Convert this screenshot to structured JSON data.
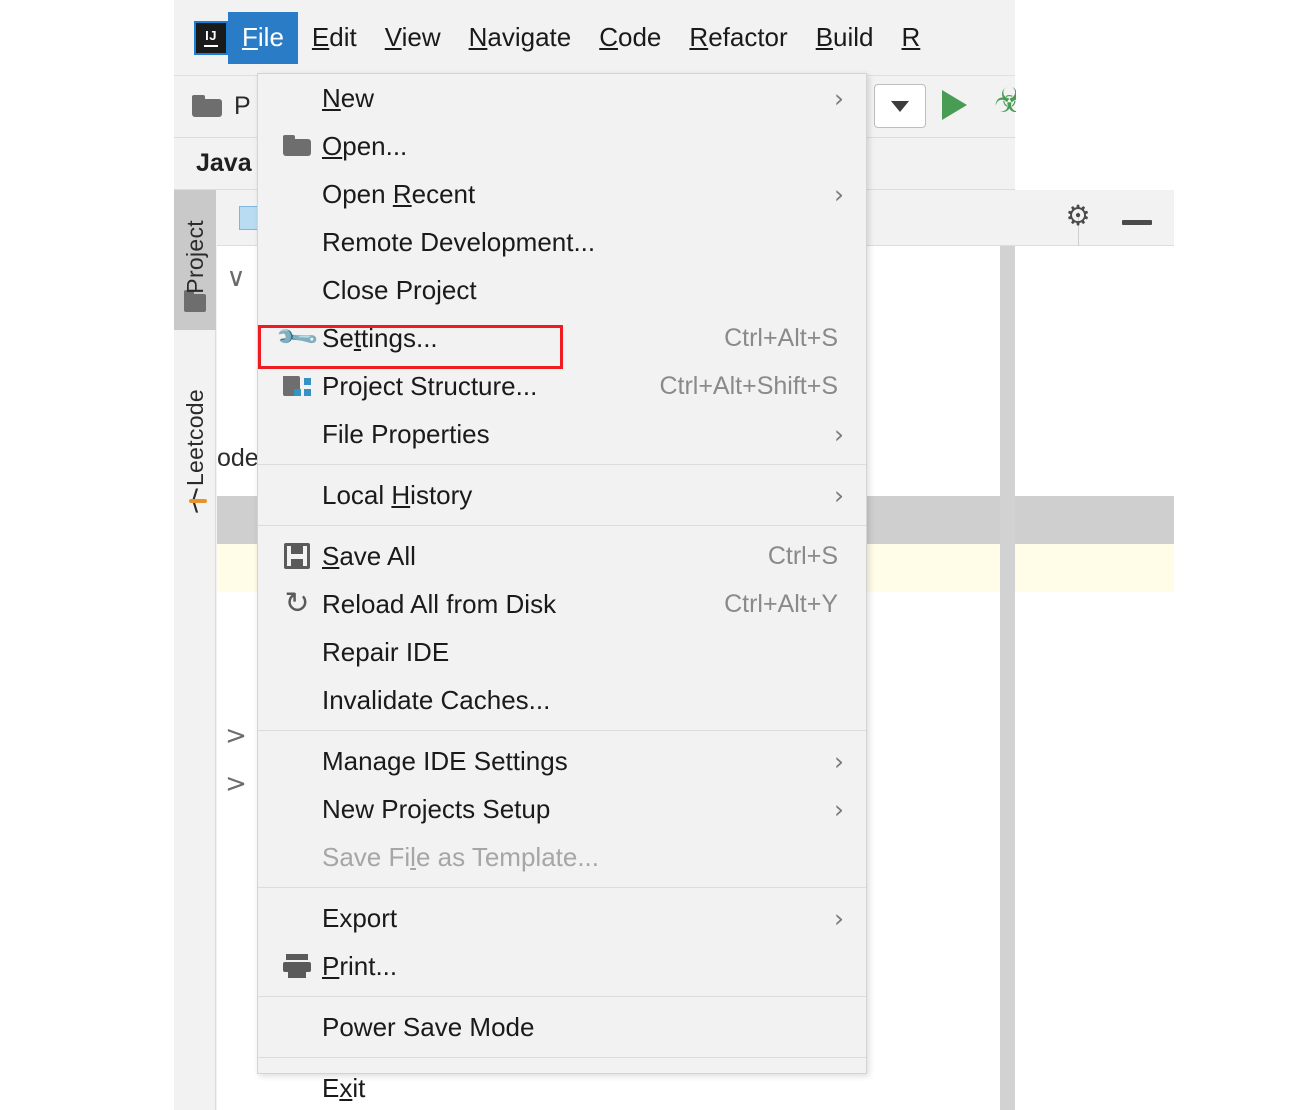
{
  "app": {
    "logo_text": "IJ",
    "breadcrumb": "Java"
  },
  "menubar": {
    "items": [
      {
        "label": "File",
        "mnemonic": "F",
        "active": true
      },
      {
        "label": "Edit",
        "mnemonic": "E",
        "active": false
      },
      {
        "label": "View",
        "mnemonic": "V",
        "active": false
      },
      {
        "label": "Navigate",
        "mnemonic": "N",
        "active": false
      },
      {
        "label": "Code",
        "mnemonic": "C",
        "active": false
      },
      {
        "label": "Refactor",
        "mnemonic": "R",
        "active": false
      },
      {
        "label": "Build",
        "mnemonic": "B",
        "active": false
      },
      {
        "label": "R",
        "mnemonic": "R",
        "active": false
      }
    ]
  },
  "toolbar": {
    "project_label": "P",
    "folder_icon": "open-folder-icon",
    "combo_icon": "chevron-down-icon",
    "run_icon": "run-triangle-icon",
    "debug_icon": "debug-bug-icon"
  },
  "sidebar": {
    "tabs": [
      {
        "label": "Project",
        "icon": "folder-icon",
        "selected": true
      },
      {
        "label": "Leetcode",
        "icon": "leetcode-icon",
        "selected": false
      }
    ]
  },
  "project_panel": {
    "header": {
      "file_icon": "file-icon",
      "gear_icon": "gear-icon",
      "gear_glyph": "⚙",
      "minimize_icon": "minimize-icon"
    },
    "partial_text": "ode",
    "rows": [
      {
        "chevron": "∨",
        "text": ""
      },
      {
        "chevron": ">",
        "text": ""
      },
      {
        "chevron": ">",
        "text": ""
      }
    ]
  },
  "file_menu": {
    "groups": [
      {
        "items": [
          {
            "label": "New",
            "mnemonic": "N",
            "icon": null,
            "shortcut": null,
            "submenu": true,
            "disabled": false
          },
          {
            "label": "Open...",
            "mnemonic": "O",
            "icon": "open-folder-icon",
            "shortcut": null,
            "submenu": false,
            "disabled": false
          },
          {
            "label": "Open Recent",
            "mnemonic": "R",
            "icon": null,
            "shortcut": null,
            "submenu": true,
            "disabled": false
          },
          {
            "label": "Remote Development...",
            "mnemonic": null,
            "icon": null,
            "shortcut": null,
            "submenu": false,
            "disabled": false
          },
          {
            "label": "Close Project",
            "mnemonic": null,
            "icon": null,
            "shortcut": null,
            "submenu": false,
            "disabled": false
          },
          {
            "label": "Settings...",
            "mnemonic": "t",
            "icon": "wrench-icon",
            "shortcut": "Ctrl+Alt+S",
            "submenu": false,
            "disabled": false,
            "highlighted": true
          },
          {
            "label": "Project Structure...",
            "mnemonic": null,
            "icon": "project-structure-icon",
            "shortcut": "Ctrl+Alt+Shift+S",
            "submenu": false,
            "disabled": false
          },
          {
            "label": "File Properties",
            "mnemonic": null,
            "icon": null,
            "shortcut": null,
            "submenu": true,
            "disabled": false
          }
        ]
      },
      {
        "items": [
          {
            "label": "Local History",
            "mnemonic": "H",
            "icon": null,
            "shortcut": null,
            "submenu": true,
            "disabled": false
          }
        ]
      },
      {
        "items": [
          {
            "label": "Save All",
            "mnemonic": "S",
            "icon": "save-icon",
            "shortcut": "Ctrl+S",
            "submenu": false,
            "disabled": false
          },
          {
            "label": "Reload All from Disk",
            "mnemonic": null,
            "icon": "reload-icon",
            "shortcut": "Ctrl+Alt+Y",
            "submenu": false,
            "disabled": false
          },
          {
            "label": "Repair IDE",
            "mnemonic": null,
            "icon": null,
            "shortcut": null,
            "submenu": false,
            "disabled": false
          },
          {
            "label": "Invalidate Caches...",
            "mnemonic": null,
            "icon": null,
            "shortcut": null,
            "submenu": false,
            "disabled": false
          }
        ]
      },
      {
        "items": [
          {
            "label": "Manage IDE Settings",
            "mnemonic": null,
            "icon": null,
            "shortcut": null,
            "submenu": true,
            "disabled": false
          },
          {
            "label": "New Projects Setup",
            "mnemonic": null,
            "icon": null,
            "shortcut": null,
            "submenu": true,
            "disabled": false
          },
          {
            "label": "Save File as Template...",
            "mnemonic": "l",
            "icon": null,
            "shortcut": null,
            "submenu": false,
            "disabled": true
          }
        ]
      },
      {
        "items": [
          {
            "label": "Export",
            "mnemonic": null,
            "icon": null,
            "shortcut": null,
            "submenu": true,
            "disabled": false
          },
          {
            "label": "Print...",
            "mnemonic": "P",
            "icon": "print-icon",
            "shortcut": null,
            "submenu": false,
            "disabled": false
          }
        ]
      },
      {
        "items": [
          {
            "label": "Power Save Mode",
            "mnemonic": null,
            "icon": null,
            "shortcut": null,
            "submenu": false,
            "disabled": false
          }
        ]
      },
      {
        "items": [
          {
            "label": "Exit",
            "mnemonic": "x",
            "icon": null,
            "shortcut": null,
            "submenu": false,
            "disabled": false
          }
        ]
      }
    ],
    "submenu_glyph": "›"
  },
  "annotation": {
    "type": "red-rectangle-highlight",
    "target": "Settings...",
    "color": "#ef1b21"
  },
  "colors": {
    "menubar_bg": "#f2f2f2",
    "active_menu_bg": "#2a7cc7",
    "menu_bg": "#f2f2f2",
    "panel_bg": "#ffffff",
    "selected_row": "#cfcfcf",
    "highlight_row": "#fffce8",
    "run_green": "#499c54",
    "accent_blue": "#3592c4"
  }
}
